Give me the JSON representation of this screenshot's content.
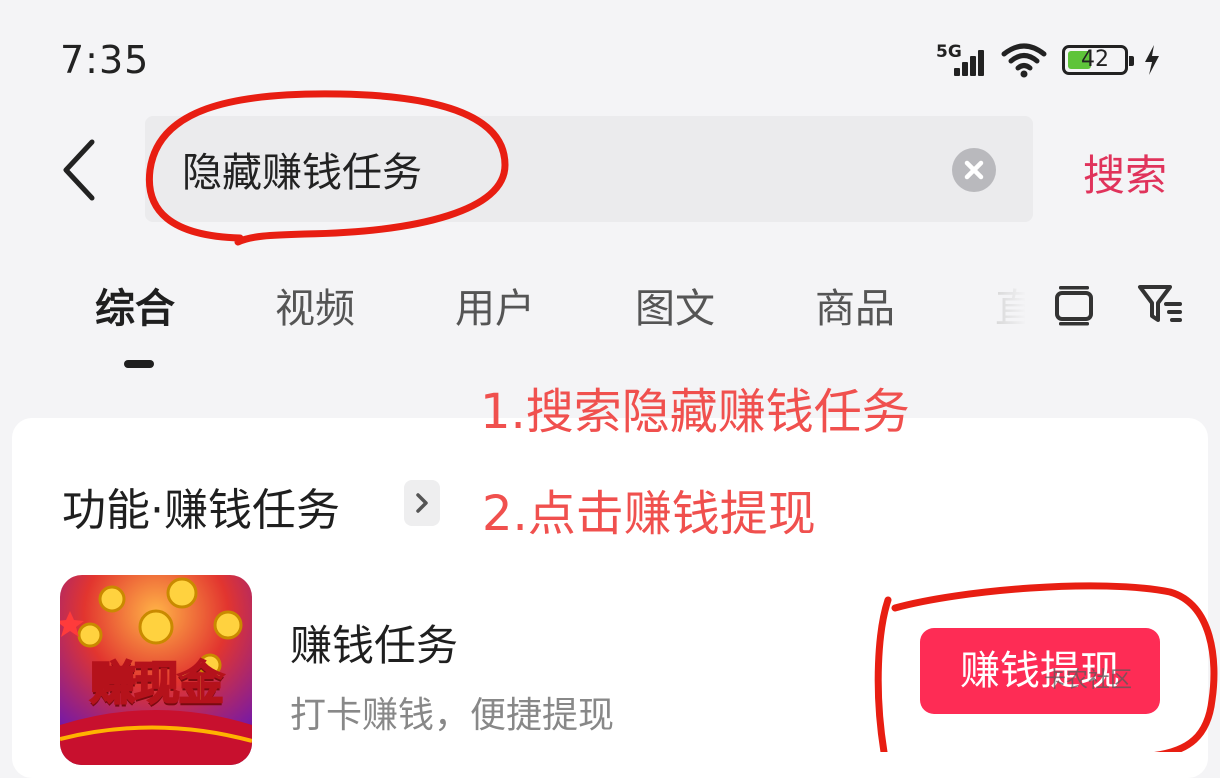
{
  "status_bar": {
    "time": "7:35",
    "network": "5G",
    "battery_level": "42",
    "battery_fraction": 0.42
  },
  "search": {
    "query": "隐藏赚钱任务",
    "submit_label": "搜索",
    "back_icon": "chevron-left-icon",
    "clear_icon": "close-circle-icon"
  },
  "tabs": [
    {
      "label": "综合",
      "active": true
    },
    {
      "label": "视频",
      "active": false
    },
    {
      "label": "用户",
      "active": false
    },
    {
      "label": "图文",
      "active": false
    },
    {
      "label": "商品",
      "active": false
    },
    {
      "label": "直",
      "active": false
    }
  ],
  "toolbar_icons": [
    "layout-icon",
    "filter-icon"
  ],
  "section": {
    "title": "功能·赚钱任务",
    "chevron_icon": "chevron-right-icon"
  },
  "result": {
    "thumb_text": "赚现金",
    "name": "赚钱任务",
    "description": "打卡赚钱，便捷提现",
    "button_label": "赚钱提现"
  },
  "watermark": "卡农社区",
  "annotations": {
    "step1": "1.搜索隐藏赚钱任务",
    "step2": "2.点击赚钱提现",
    "color": "#f0504e"
  },
  "colors": {
    "accent": "#fe2c55",
    "search_text_accent": "#e0335b",
    "background": "#f4f4f6",
    "card": "#ffffff"
  }
}
